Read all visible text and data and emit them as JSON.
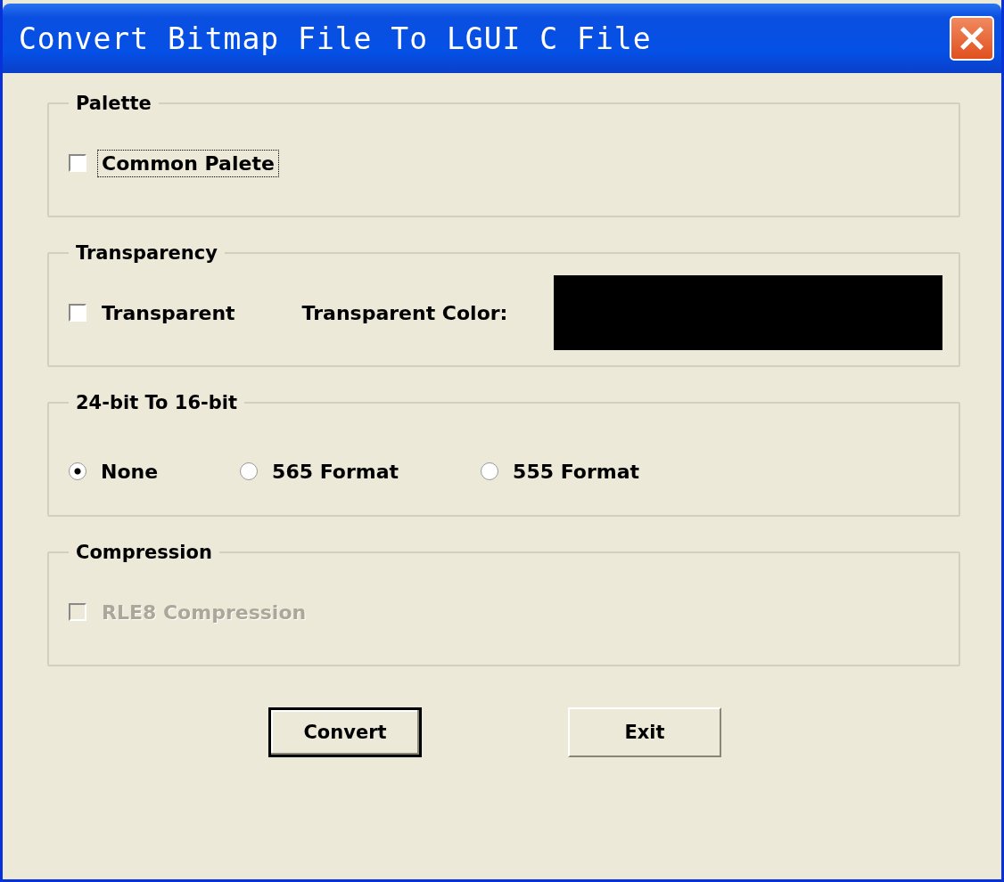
{
  "window": {
    "title": "Convert Bitmap File To LGUI C File"
  },
  "groups": [
    {
      "title": "Palette",
      "items": [
        {
          "kind": "checkbox",
          "label": "Common Palete",
          "checked": false,
          "disabled": false,
          "focused": true
        }
      ]
    },
    {
      "title": "Transparency",
      "items": [
        {
          "kind": "checkbox",
          "label": "Transparent",
          "checked": false,
          "disabled": false,
          "focused": false
        },
        {
          "kind": "color",
          "label": "Transparent Color:",
          "color": "#000000"
        }
      ]
    },
    {
      "title": "24-bit To 16-bit",
      "items": [
        {
          "kind": "radio",
          "label": "None",
          "selected": true
        },
        {
          "kind": "radio",
          "label": "565 Format",
          "selected": false
        },
        {
          "kind": "radio",
          "label": "555 Format",
          "selected": false
        }
      ]
    },
    {
      "title": "Compression",
      "items": [
        {
          "kind": "checkbox",
          "label": "RLE8 Compression",
          "checked": false,
          "disabled": true,
          "focused": false
        }
      ]
    }
  ],
  "buttons": [
    {
      "label": "Convert",
      "default": true
    },
    {
      "label": "Exit",
      "default": false
    }
  ]
}
